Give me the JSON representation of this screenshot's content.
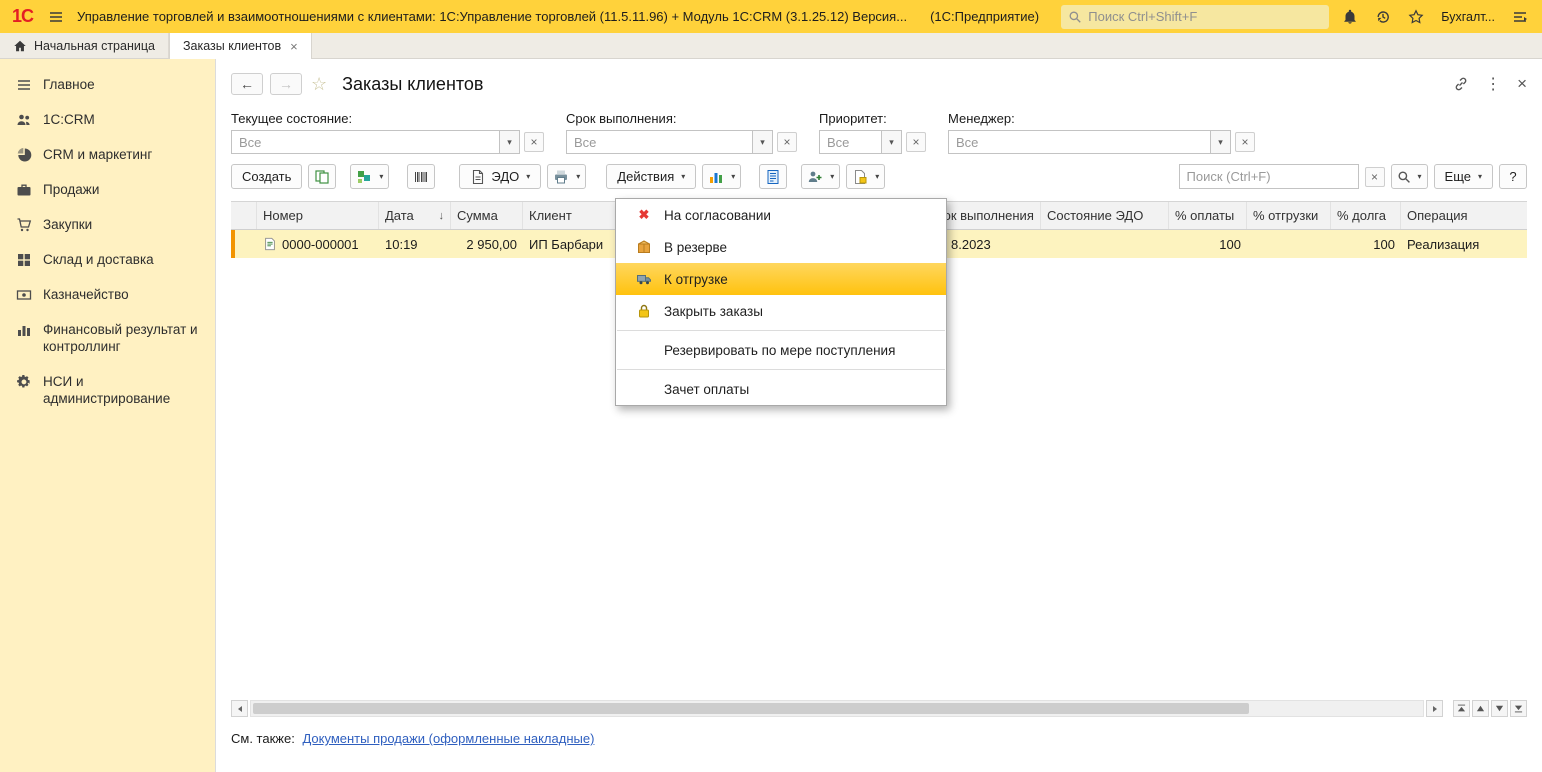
{
  "glyphs": {
    "caret": "▾",
    "close": "×",
    "kebab": "⋮",
    "back": "←",
    "forward": "→",
    "star": "☆",
    "sort_desc": "↓",
    "red_cross": "✖"
  },
  "topbar": {
    "logo": "1С",
    "title": "Управление торговлей и взаимоотношениями с клиентами: 1С:Управление торговлей (11.5.11.96) + Модуль 1С:CRM (3.1.25.12) Версия...",
    "product": "(1С:Предприятие)",
    "search_placeholder": "Поиск Ctrl+Shift+F",
    "user": "Бухгалт..."
  },
  "tabs": [
    {
      "label": "Начальная страница"
    },
    {
      "label": "Заказы клиентов"
    }
  ],
  "sidebar": {
    "items": [
      {
        "label": "Главное",
        "icon": "menu-icon"
      },
      {
        "label": "1С:CRM",
        "icon": "users-icon"
      },
      {
        "label": "CRM и маркетинг",
        "icon": "pie-chart-icon"
      },
      {
        "label": "Продажи",
        "icon": "briefcase-icon"
      },
      {
        "label": "Закупки",
        "icon": "cart-icon"
      },
      {
        "label": "Склад и доставка",
        "icon": "boxes-icon"
      },
      {
        "label": "Казначейство",
        "icon": "banknote-icon"
      },
      {
        "label": "Финансовый результат и контроллинг",
        "icon": "bar-chart-icon"
      },
      {
        "label": "НСИ и администрирование",
        "icon": "gear-icon"
      }
    ]
  },
  "page": {
    "title": "Заказы клиентов"
  },
  "filters": [
    {
      "label": "Текущее состояние:",
      "value": "Все"
    },
    {
      "label": "Срок выполнения:",
      "value": "Все"
    },
    {
      "label": "Приоритет:",
      "value": "Все"
    },
    {
      "label": "Менеджер:",
      "value": "Все"
    }
  ],
  "toolbar": {
    "create": "Создать",
    "edo": "ЭДО",
    "actions": "Действия",
    "more": "Еще",
    "help": "?",
    "search_placeholder": "Поиск (Ctrl+F)"
  },
  "menu": {
    "items": [
      {
        "label": "На согласовании",
        "icon": "red-cross-icon"
      },
      {
        "label": "В резерве",
        "icon": "box-icon"
      },
      {
        "label": "К отгрузке",
        "icon": "truck-icon",
        "highlighted": true
      },
      {
        "label": "Закрыть заказы",
        "icon": "lock-icon"
      },
      {
        "label": "Резервировать по мере поступления",
        "icon": ""
      },
      {
        "label": "Зачет оплаты",
        "icon": ""
      }
    ]
  },
  "table": {
    "columns": [
      "Номер",
      "Дата",
      "Сумма",
      "Клиент",
      "Срок выполнения",
      "Состояние ЭДО",
      "% оплаты",
      "% отгрузки",
      "% долга",
      "Операция"
    ],
    "sort": {
      "column": "Дата",
      "direction": "desc"
    },
    "rows": [
      {
        "number": "0000-000001",
        "date": "10:19",
        "sum": "2 950,00",
        "client": "ИП Барбари",
        "due": "8.2023",
        "edo": "",
        "payment_pct": "100",
        "shipment_pct": "",
        "debt_pct": "100",
        "operation": "Реализация"
      }
    ]
  },
  "footer": {
    "see_also": "См. также:",
    "link": "Документы продажи (оформленные накладные)"
  }
}
